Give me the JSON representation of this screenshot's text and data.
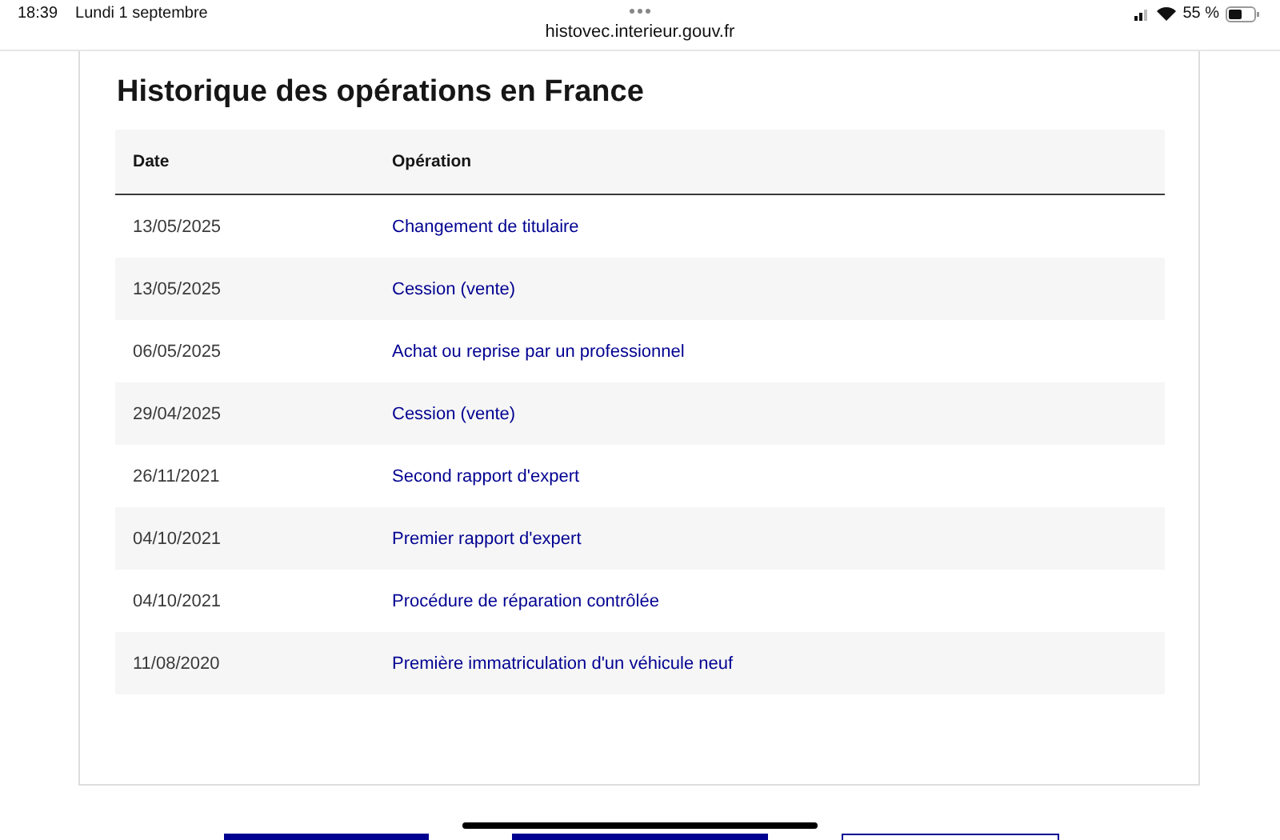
{
  "status_bar": {
    "time": "18:39",
    "date": "Lundi 1 septembre",
    "url": "histovec.interieur.gouv.fr",
    "battery": "55 %"
  },
  "card": {
    "title": "Historique des opérations en France",
    "table": {
      "columns": [
        "Date",
        "Opération"
      ],
      "rows": [
        {
          "date": "13/05/2025",
          "operation": "Changement de titulaire"
        },
        {
          "date": "13/05/2025",
          "operation": "Cession (vente)"
        },
        {
          "date": "06/05/2025",
          "operation": "Achat ou reprise par un professionnel"
        },
        {
          "date": "29/04/2025",
          "operation": "Cession (vente)"
        },
        {
          "date": "26/11/2021",
          "operation": "Second rapport d'expert"
        },
        {
          "date": "04/10/2021",
          "operation": "Premier rapport d'expert"
        },
        {
          "date": "04/10/2021",
          "operation": "Procédure de réparation contrôlée"
        },
        {
          "date": "11/08/2020",
          "operation": "Première immatriculation d'un véhicule neuf"
        }
      ]
    }
  },
  "bottom_buttons": [
    {
      "kind": "filled"
    },
    {
      "kind": "filled"
    },
    {
      "kind": "outlined"
    }
  ]
}
